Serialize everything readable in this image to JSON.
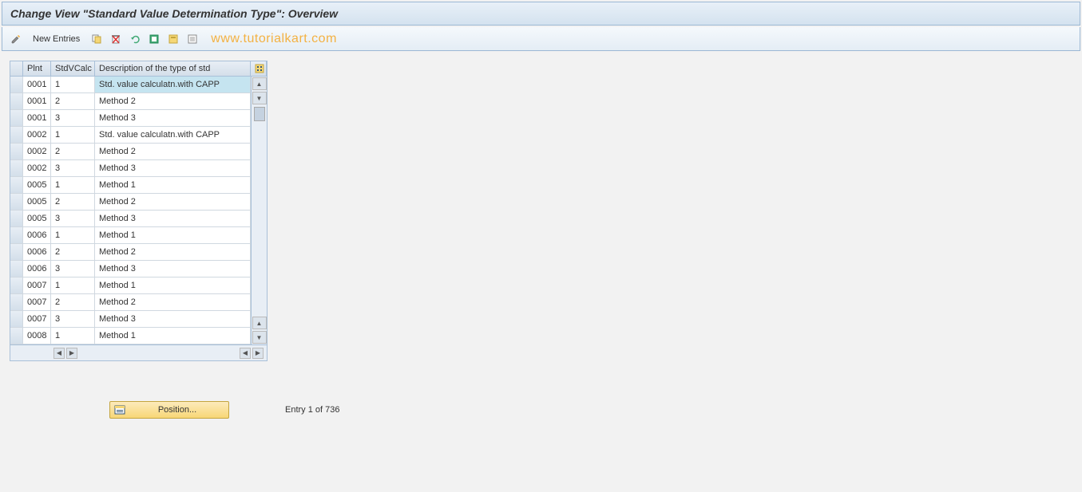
{
  "title": "Change View \"Standard Value Determination Type\": Overview",
  "toolbar": {
    "new_entries_label": "New Entries"
  },
  "watermark": "www.tutorialkart.com",
  "grid": {
    "headers": {
      "plnt": "Plnt",
      "stdvcalc": "StdVCalc",
      "desc": "Description of the type of std"
    },
    "rows": [
      {
        "plnt": "0001",
        "stdvcalc": "1",
        "desc": "Std. value calculatn.with CAPP",
        "highlighted": true
      },
      {
        "plnt": "0001",
        "stdvcalc": "2",
        "desc": "Method 2"
      },
      {
        "plnt": "0001",
        "stdvcalc": "3",
        "desc": "Method 3"
      },
      {
        "plnt": "0002",
        "stdvcalc": "1",
        "desc": "Std. value calculatn.with CAPP"
      },
      {
        "plnt": "0002",
        "stdvcalc": "2",
        "desc": "Method 2"
      },
      {
        "plnt": "0002",
        "stdvcalc": "3",
        "desc": "Method 3"
      },
      {
        "plnt": "0005",
        "stdvcalc": "1",
        "desc": "Method 1"
      },
      {
        "plnt": "0005",
        "stdvcalc": "2",
        "desc": "Method 2"
      },
      {
        "plnt": "0005",
        "stdvcalc": "3",
        "desc": "Method 3"
      },
      {
        "plnt": "0006",
        "stdvcalc": "1",
        "desc": "Method 1"
      },
      {
        "plnt": "0006",
        "stdvcalc": "2",
        "desc": "Method 2"
      },
      {
        "plnt": "0006",
        "stdvcalc": "3",
        "desc": "Method 3"
      },
      {
        "plnt": "0007",
        "stdvcalc": "1",
        "desc": "Method 1"
      },
      {
        "plnt": "0007",
        "stdvcalc": "2",
        "desc": "Method 2"
      },
      {
        "plnt": "0007",
        "stdvcalc": "3",
        "desc": "Method 3"
      },
      {
        "plnt": "0008",
        "stdvcalc": "1",
        "desc": "Method 1"
      }
    ]
  },
  "footer": {
    "position_button_label": "Position...",
    "entry_status": "Entry 1 of 736"
  }
}
